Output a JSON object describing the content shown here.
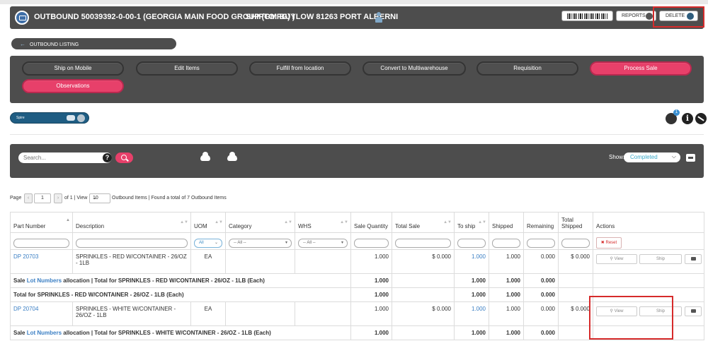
{
  "header": {
    "title": "OUTBOUND 50039392-0-00-1 (GEORGIA MAIN FOOD GROUP (GMFG) )",
    "shipto": "SHIPTO: BUYLOW 81263 PORT ALBERNI",
    "reports_label": "REPORTS",
    "delete_label": "DELETE"
  },
  "nav": {
    "outbound_listing": "OUTBOUND LISTING"
  },
  "actions": {
    "ship_on_mobile": "Ship on Mobile",
    "edit_items": "Edit Items",
    "fulfill_from_location": "Fulfill from location",
    "convert_multiwarehouse": "Convert to Multiwarehouse",
    "requisition": "Requisition",
    "process_sale": "Process Sale",
    "observations": "Observations"
  },
  "integration": {
    "spire_label": "Spire",
    "notification_count": "1",
    "info_glyph": "i"
  },
  "search": {
    "placeholder": "Search...",
    "help_glyph": "?",
    "show_label": "Show:",
    "show_value": "Completed"
  },
  "pager": {
    "page_label": "Page",
    "page_value": "1",
    "of_text": "of 1 | View",
    "view_value": "10",
    "items_text": "Outbound Items | Found a total of 7 Outbound Items"
  },
  "table": {
    "columns": {
      "part_number": "Part Number",
      "description": "Description",
      "uom": "UOM",
      "category": "Category",
      "whs": "WHS",
      "sale_quantity": "Sale Quantity",
      "total_sale": "Total Sale",
      "to_ship": "To ship",
      "shipped": "Shipped",
      "remaining": "Remaining",
      "total_shipped": "Total Shipped",
      "actions": "Actions"
    },
    "filters": {
      "uom": "All",
      "category": "-- All --",
      "whs": "-- All --",
      "reset": "Reset"
    },
    "rows": [
      {
        "part": "DP 20703",
        "description": "SPRINKLES - RED W/CONTAINER - 26/OZ - 1LB",
        "uom": "EA",
        "sale_qty": "1.000",
        "total_sale": "$ 0.000",
        "to_ship": "1.000",
        "shipped": "1.000",
        "remaining": "0.000",
        "total_shipped": "$ 0.000",
        "alloc_prefix": "Sale",
        "alloc_link": "Lot Numbers",
        "alloc_suffix": "allocation | Total for SPRINKLES - RED W/CONTAINER - 26/OZ - 1LB (Each)",
        "alloc_sale": "1.000",
        "alloc_to_ship": "1.000",
        "alloc_shipped": "1.000",
        "alloc_remaining": "0.000",
        "total_label": "Total for SPRINKLES - RED W/CONTAINER - 26/OZ - 1LB (Each)",
        "total_sale_qty": "1.000",
        "total_to_ship": "1.000",
        "total_shipped_qty": "1.000",
        "total_remaining": "0.000"
      },
      {
        "part": "DP 20704",
        "description": "SPRINKLES - WHITE W/CONTAINER - 26/OZ - 1LB",
        "uom": "EA",
        "sale_qty": "1.000",
        "total_sale": "$ 0.000",
        "to_ship": "1.000",
        "shipped": "1.000",
        "remaining": "0.000",
        "total_shipped": "$ 0.000",
        "alloc_prefix": "Sale",
        "alloc_link": "Lot Numbers",
        "alloc_suffix": "allocation | Total for SPRINKLES - WHITE W/CONTAINER - 26/OZ - 1LB (Each)",
        "alloc_sale": "1.000",
        "alloc_to_ship": "1.000",
        "alloc_shipped": "1.000",
        "alloc_remaining": "0.000"
      }
    ],
    "view_label": "View",
    "ship_label": "Ship"
  }
}
